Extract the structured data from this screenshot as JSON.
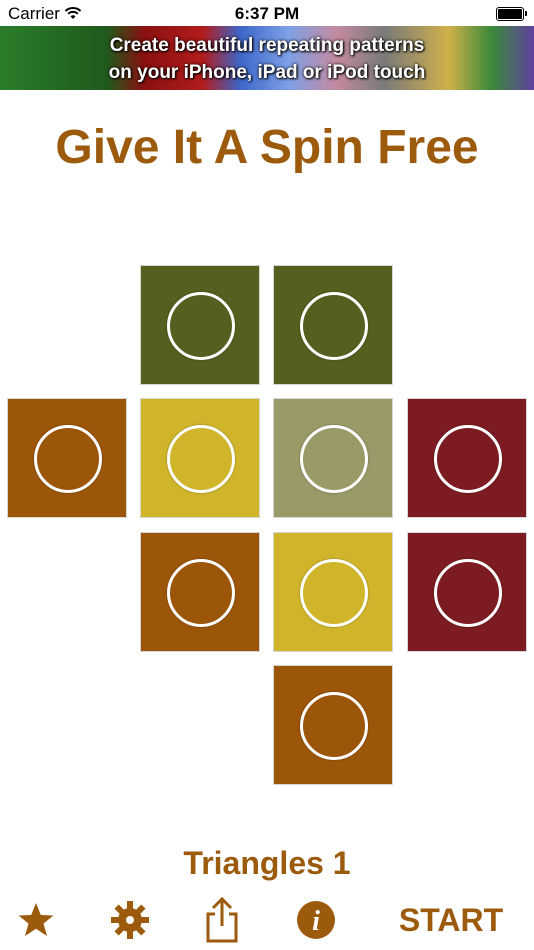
{
  "status_bar": {
    "carrier": "Carrier",
    "time": "6:37 PM"
  },
  "banner": {
    "line1": "Create beautiful repeating patterns",
    "line2": "on your iPhone, iPad or iPod touch"
  },
  "title": "Give It A Spin Free",
  "pattern_name": "Triangles 1",
  "toolbar": {
    "star_icon": "star-icon",
    "settings_icon": "gear-icon",
    "share_icon": "share-icon",
    "info_icon": "info-icon",
    "start_label": "START"
  },
  "colors": {
    "accent": "#9b5a0c",
    "olive": "#53601f",
    "orange": "#9c560a",
    "mustard": "#d0b52b",
    "sage": "#9a9a68",
    "crimson": "#7c1c22"
  },
  "tiles": [
    {
      "color": "olive"
    },
    {
      "color": "olive"
    },
    {
      "color": "orange"
    },
    {
      "color": "mustard"
    },
    {
      "color": "sage"
    },
    {
      "color": "crimson"
    },
    {
      "color": "orange"
    },
    {
      "color": "mustard"
    },
    {
      "color": "crimson"
    },
    {
      "color": "orange"
    }
  ]
}
